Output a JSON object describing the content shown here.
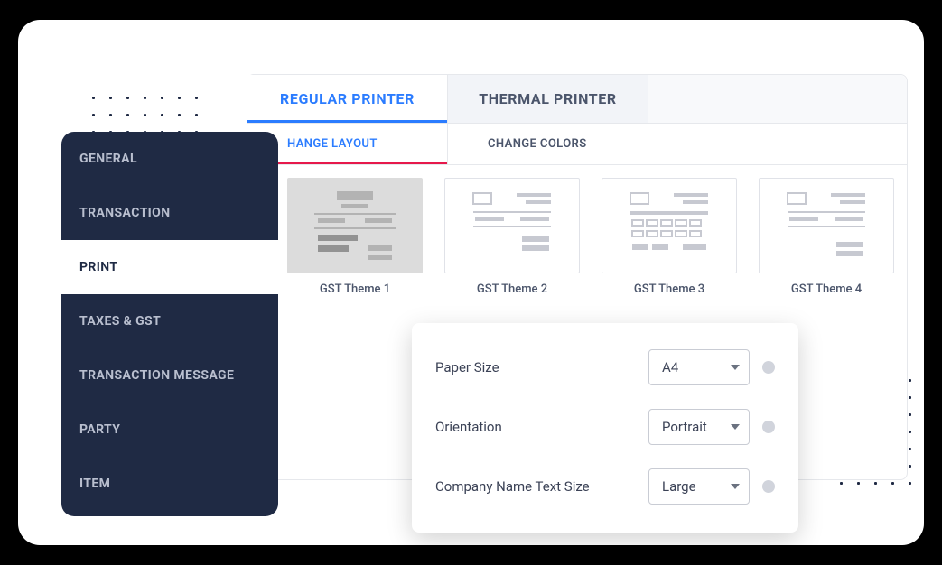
{
  "sidebar": {
    "items": [
      {
        "label": "GENERAL"
      },
      {
        "label": "TRANSACTION"
      },
      {
        "label": "PRINT"
      },
      {
        "label": "TAXES & GST"
      },
      {
        "label": "TRANSACTION MESSAGE"
      },
      {
        "label": "PARTY"
      },
      {
        "label": "ITEM"
      }
    ]
  },
  "tabs_primary": [
    {
      "label": "REGULAR PRINTER"
    },
    {
      "label": "THERMAL PRINTER"
    }
  ],
  "tabs_secondary": [
    {
      "label": "HANGE LAYOUT"
    },
    {
      "label": "CHANGE COLORS"
    }
  ],
  "themes": [
    {
      "label": "GST Theme 1"
    },
    {
      "label": "GST Theme 2"
    },
    {
      "label": "GST Theme 3"
    },
    {
      "label": "GST Theme 4"
    }
  ],
  "settings": {
    "paper_size": {
      "label": "Paper Size",
      "value": "A4"
    },
    "orientation": {
      "label": "Orientation",
      "value": "Portrait"
    },
    "company_name_text_size": {
      "label": "Company Name Text Size",
      "value": "Large"
    }
  }
}
